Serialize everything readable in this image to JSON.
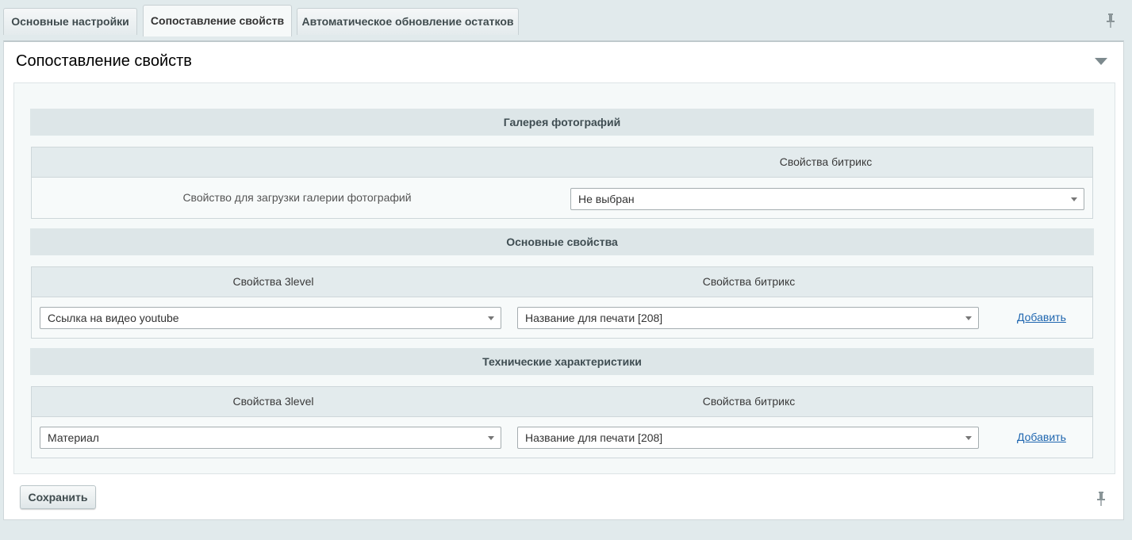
{
  "tabs": [
    {
      "label": "Основные настройки"
    },
    {
      "label": "Сопоставление свойств"
    },
    {
      "label": "Автоматическое обновление остатков"
    }
  ],
  "panel": {
    "title": "Сопоставление свойств"
  },
  "gallery": {
    "title": "Галерея фотографий",
    "col_bitrix": "Свойства битрикс",
    "row_label": "Свойство для загрузки галерии фотографий",
    "select_value": "Не выбран"
  },
  "basic": {
    "title": "Основные свойства",
    "col_3level": "Свойства 3level",
    "col_bitrix": "Свойства битрикс",
    "left_value": "Ссылка на видео youtube",
    "right_value": "Название для печати [208]",
    "add_label": "Добавить"
  },
  "tech": {
    "title": "Технические характеристики",
    "col_3level": "Свойства 3level",
    "col_bitrix": "Свойства битрикс",
    "left_value": "Материал",
    "right_value": "Название для печати [208]",
    "add_label": "Добавить"
  },
  "save_label": "Сохранить",
  "icons": {
    "pin": "pin-icon",
    "collapse": "chevron-down-icon",
    "dropdown": "dropdown-arrow-icon"
  }
}
